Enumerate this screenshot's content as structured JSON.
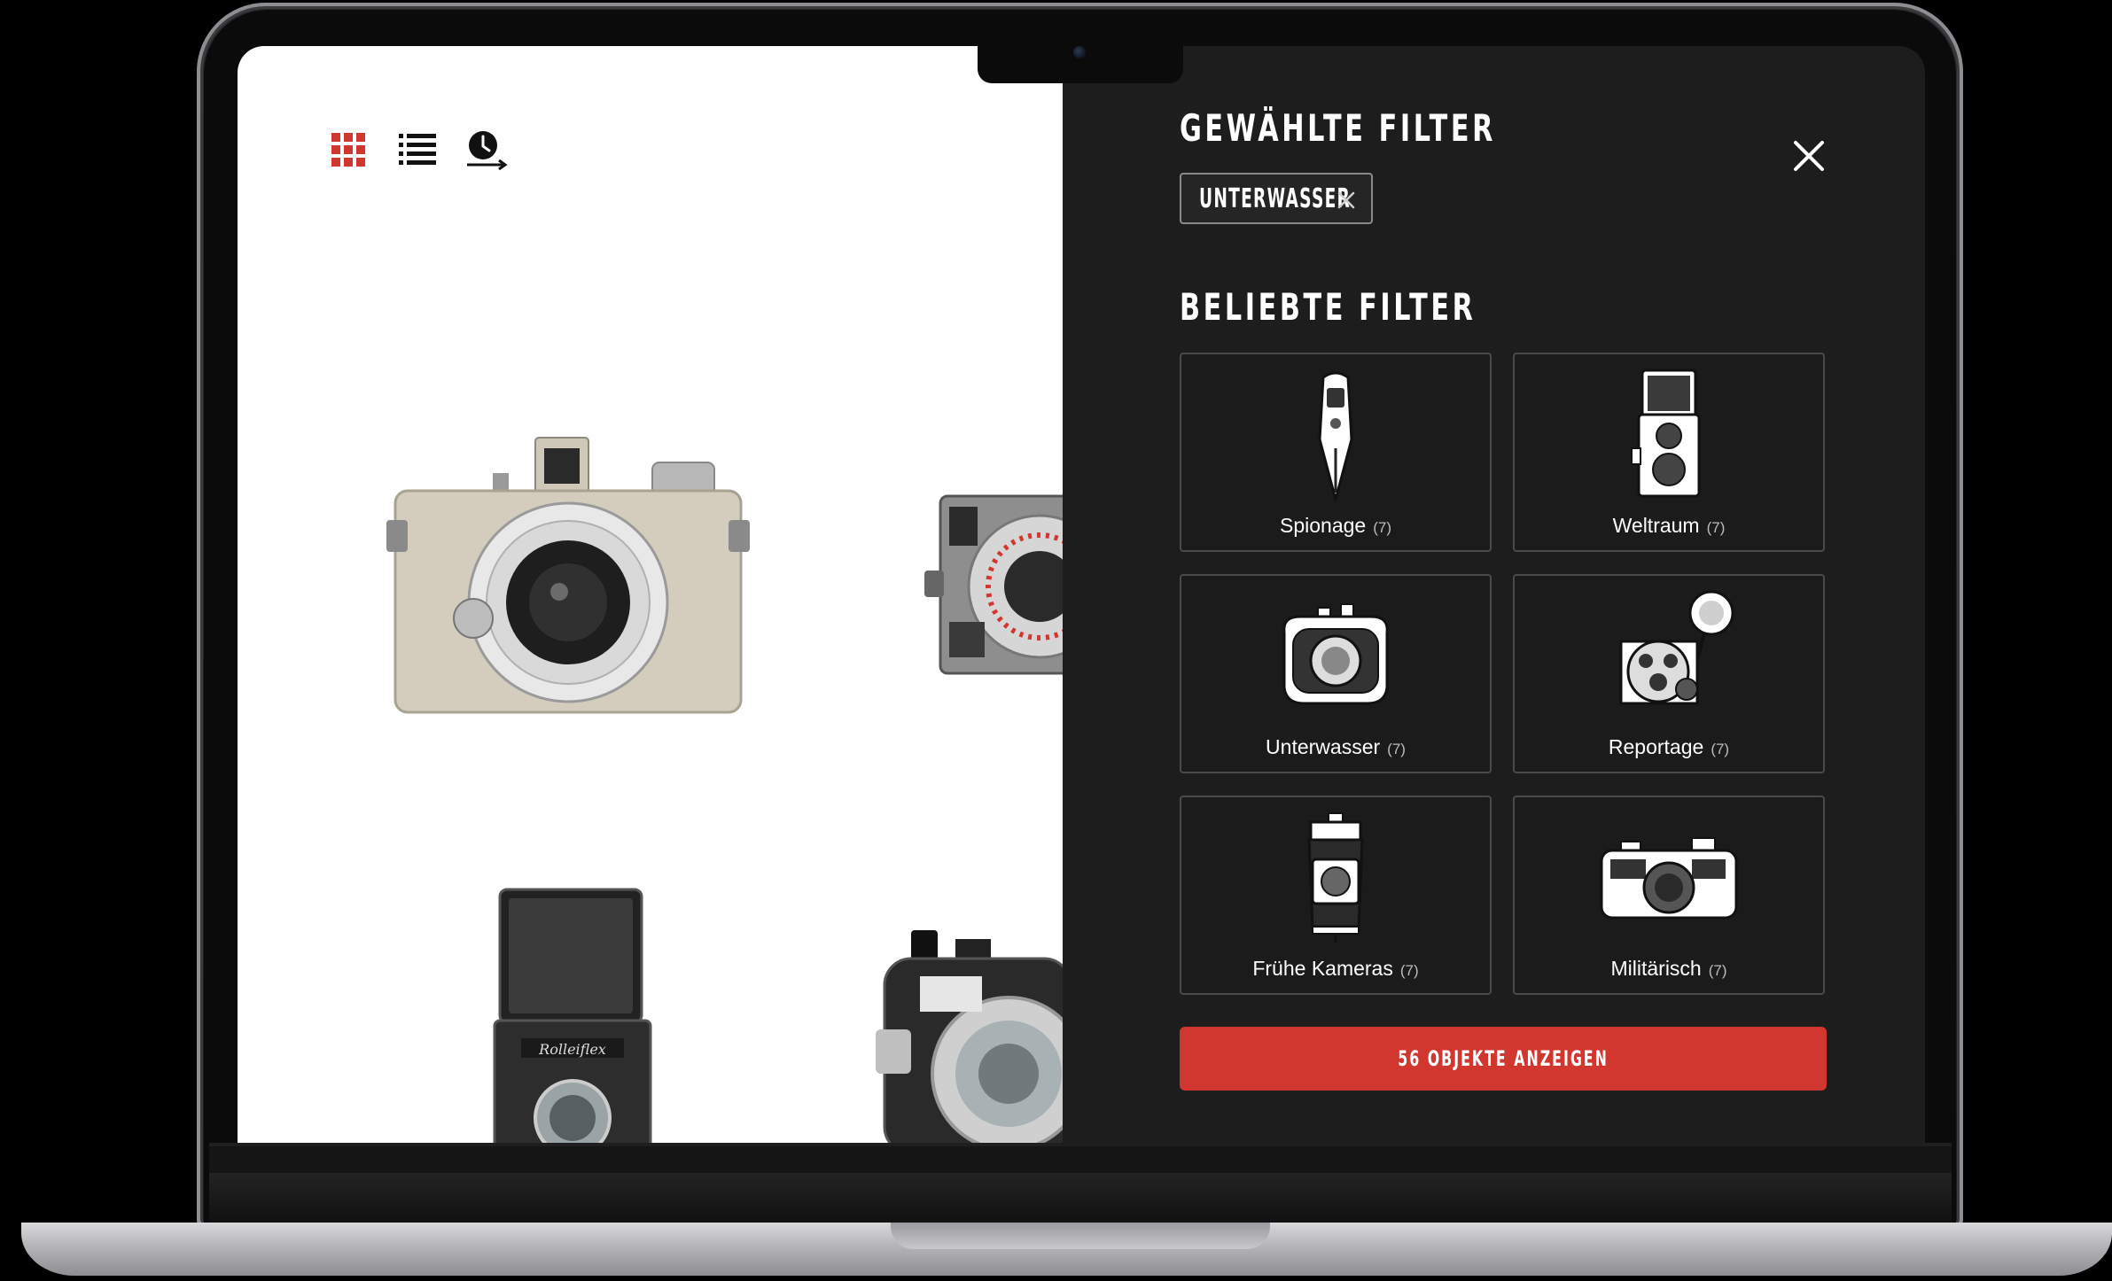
{
  "colors": {
    "accent": "#d1362f",
    "panel_background": "#1d1d1d",
    "tile_border": "#4a4a4a",
    "grid_icon_active": "#d1362f"
  },
  "toolbar": {
    "icons": [
      "grid-view-icon",
      "list-view-icon",
      "timeline-view-icon"
    ]
  },
  "filter_panel": {
    "selected_heading": "GEWÄHLTE FILTER",
    "selected_filters": [
      {
        "label": "UNTERWASSER",
        "remove_icon": "close-icon"
      }
    ],
    "popular_heading": "BELIEBTE FILTER",
    "popular_filters": [
      {
        "name": "Spionage",
        "count": "(7)",
        "icon": "spy-camera-icon"
      },
      {
        "name": "Weltraum",
        "count": "(7)",
        "icon": "twin-lens-camera-icon"
      },
      {
        "name": "Unterwasser",
        "count": "(7)",
        "icon": "underwater-camera-icon"
      },
      {
        "name": "Reportage",
        "count": "(7)",
        "icon": "flash-camera-icon"
      },
      {
        "name": "Frühe Kameras",
        "count": "(7)",
        "icon": "folding-camera-icon"
      },
      {
        "name": "Militärisch",
        "count": "(7)",
        "icon": "rangefinder-camera-icon"
      }
    ],
    "cta_label": "56 OBJEKTE ANZEIGEN",
    "close_icon": "close-icon"
  }
}
